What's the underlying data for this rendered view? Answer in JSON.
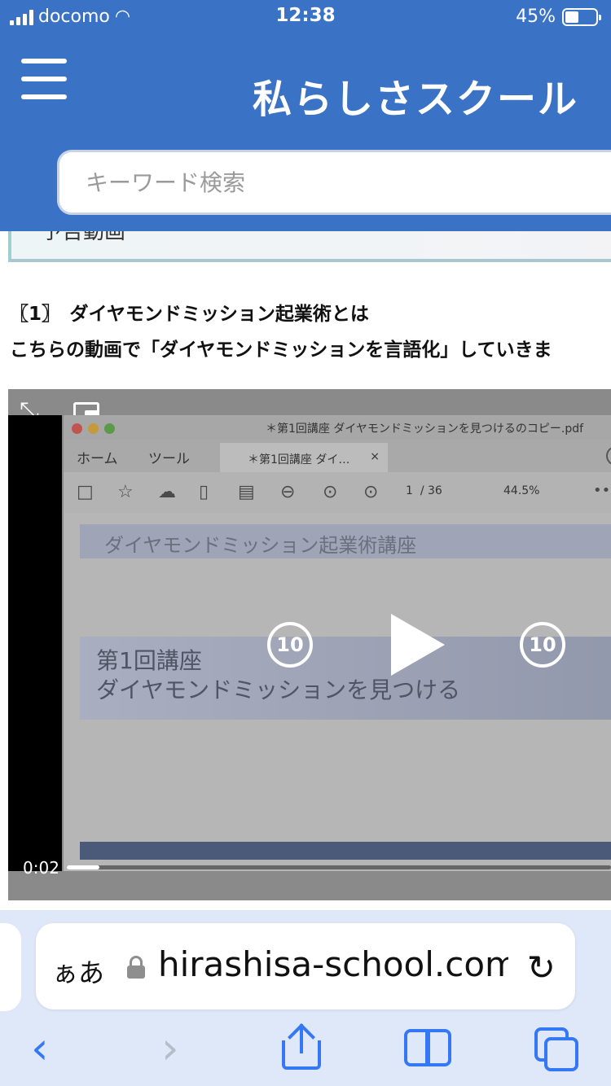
{
  "status": {
    "carrier": "docomo",
    "time": "12:38",
    "battery": "45%",
    "battery_level": 0.45
  },
  "header": {
    "title": "私らしさスクール",
    "search_placeholder": "キーワード検索"
  },
  "content": {
    "teaser_text": "予告動画",
    "section_title": "〖1〗　ダイヤモンドミッション起業術とは",
    "section_text": "こちらの動画で「ダイヤモンドミッションを言語化」していきま"
  },
  "video": {
    "pdf_filename": "＊第1回講座 ダイヤモンドミッションを見つけるのコピー.pdf",
    "pdf_menu_home": "ホーム",
    "pdf_menu_tools": "ツール",
    "pdf_doc_tab": "＊第1回講座 ダイ…",
    "pdf_tab_close": "×",
    "pdf_page_current": "1",
    "pdf_page_total": "/ 36",
    "pdf_zoom": "44.5%",
    "course_title": "ダイヤモンドミッション起業術講座",
    "lecture_line1": "第1回講座",
    "lecture_line2": "ダイヤモンドミッションを見つける",
    "skip_back": "10",
    "skip_forward": "10",
    "elapsed": "0:02",
    "progress": 0.01
  },
  "browser": {
    "aa_label": "ぁあ",
    "url": "watashirashisa-school.com",
    "url_visible": "hirashisa-school.com"
  },
  "colors": {
    "brand_blue": "#3a73c6",
    "ios_blue": "#3478f6"
  }
}
